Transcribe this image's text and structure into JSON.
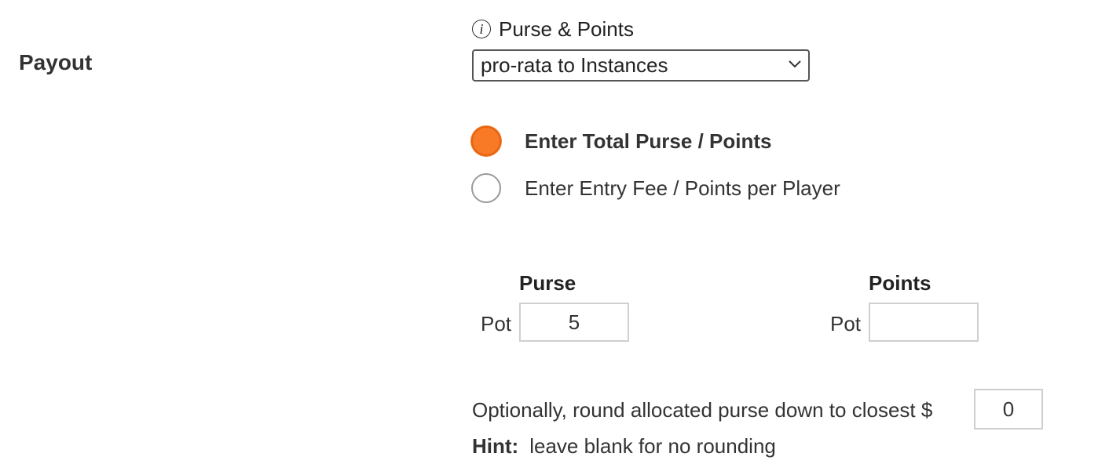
{
  "section": {
    "title": "Payout"
  },
  "payout": {
    "label": "Purse & Points",
    "info_icon": "info-icon",
    "select_value": "pro-rata to Instances",
    "select_icon": "chevron-down-icon",
    "radio_options": [
      {
        "label": "Enter Total Purse / Points",
        "selected": true
      },
      {
        "label": "Enter Entry Fee / Points per Player",
        "selected": false
      }
    ],
    "accent_color": "#f97a26"
  },
  "pot": {
    "purse_header": "Purse",
    "points_header": "Points",
    "purse_pot_label": "Pot",
    "points_pot_label": "Pot",
    "purse_value": "5",
    "points_value": ""
  },
  "rounding": {
    "text": "Optionally, round allocated purse down to closest $",
    "value": "0",
    "hint_label": "Hint:",
    "hint_text": "leave blank for no rounding"
  }
}
